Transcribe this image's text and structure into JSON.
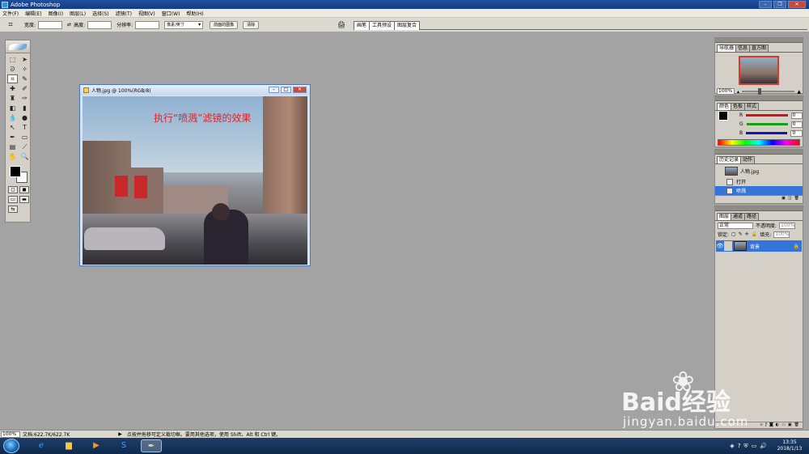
{
  "app": {
    "title": "Adobe Photoshop"
  },
  "menu": [
    "文件(F)",
    "编辑(E)",
    "图像(I)",
    "图层(L)",
    "选择(S)",
    "滤镜(T)",
    "视图(V)",
    "窗口(W)",
    "帮助(H)"
  ],
  "options": {
    "width_label": "宽度:",
    "height_label": "高度:",
    "resolution_label": "分辨率:",
    "unit_select": "像素/英寸",
    "front_image_button": "前面的图像",
    "clear_button": "清除"
  },
  "palette_well": {
    "tabs": [
      "画笔",
      "工具预设",
      "图层复合"
    ]
  },
  "document": {
    "title": "人物.jpg @ 100%(RGB/8)",
    "caption": "执行“喷溅”滤镜的效果"
  },
  "navigator": {
    "tabs": [
      "导航器",
      "信息",
      "直方图"
    ],
    "zoom": "100%"
  },
  "color_panel": {
    "tabs": [
      "颜色",
      "色板",
      "样式"
    ],
    "channels": [
      {
        "label": "R",
        "value": "0",
        "color": "#d21414"
      },
      {
        "label": "G",
        "value": "0",
        "color": "#14a014"
      },
      {
        "label": "B",
        "value": "0",
        "color": "#1414b4"
      }
    ]
  },
  "history_panel": {
    "tabs": [
      "历史记录",
      "动作"
    ],
    "snapshot": "人物.jpg",
    "items": [
      "打开",
      "喷溅"
    ]
  },
  "layers_panel": {
    "tabs": [
      "图层",
      "通道",
      "路径"
    ],
    "blend_mode": "正常",
    "opacity_label": "不透明度:",
    "opacity_value": "100%",
    "lock_label": "锁定:",
    "fill_label": "填充:",
    "fill_value": "100%",
    "layer_name": "背景"
  },
  "status": {
    "zoom": "100%",
    "doc_info": "文档:622.7K/622.7K",
    "hint": "点按并拖移可定义裁切框。要用其他选项，使用 Shift、Alt 和 Ctrl 键。"
  },
  "taskbar": {
    "time": "13:35",
    "date": "2018/1/13"
  },
  "watermark": {
    "brand": "Baid经验",
    "url": "jingyan.baidu.com"
  },
  "colors": {
    "accent": "#3574d8",
    "caption_red": "#e0232a"
  }
}
